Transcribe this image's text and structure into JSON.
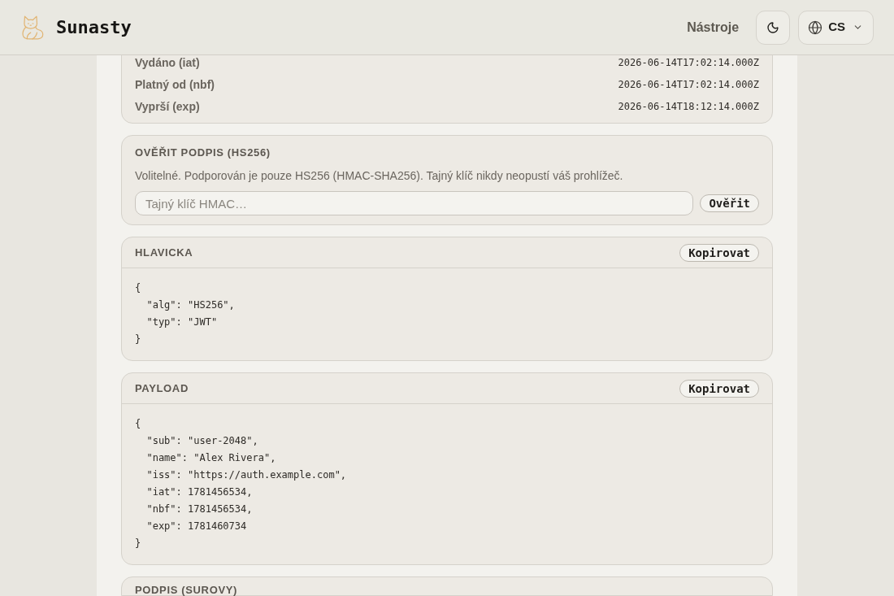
{
  "header": {
    "brand": "Sunasty",
    "nav_link": "Nástroje",
    "language": "CS"
  },
  "claims": [
    {
      "label": "Vydáno (iat)",
      "value": "2026-06-14T17:02:14.000Z"
    },
    {
      "label": "Platný od (nbf)",
      "value": "2026-06-14T17:02:14.000Z"
    },
    {
      "label": "Vyprší (exp)",
      "value": "2026-06-14T18:12:14.000Z"
    }
  ],
  "verify": {
    "title": "OVĚŘIT PODPIS (HS256)",
    "description": "Volitelné. Podporován je pouze HS256 (HMAC-SHA256). Tajný klíč nikdy neopustí váš prohlížeč.",
    "input": {
      "placeholder": "Tajný klíč HMAC…"
    },
    "button": "Ověřit"
  },
  "sections": [
    {
      "title": "HLAVICKA",
      "button": "Kopirovat",
      "code": "{\n  \"alg\": \"HS256\",\n  \"typ\": \"JWT\"\n}"
    },
    {
      "title": "PAYLOAD",
      "button": "Kopirovat",
      "code": "{\n  \"sub\": \"user-2048\",\n  \"name\": \"Alex Rivera\",\n  \"iss\": \"https://auth.example.com\",\n  \"iat\": 1781456534,\n  \"nbf\": 1781456534,\n  \"exp\": 1781460734\n}"
    }
  ],
  "next_section": {
    "title": "PODPIS (SUROVY)"
  }
}
